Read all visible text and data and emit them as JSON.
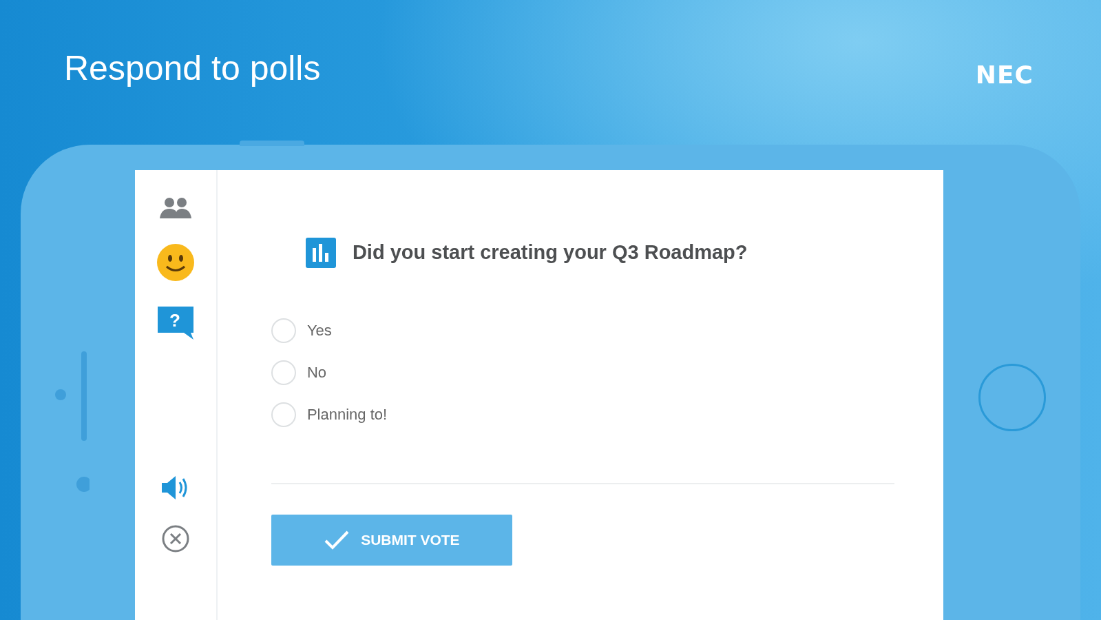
{
  "header": {
    "title": "Respond to polls",
    "logo": "NEC"
  },
  "sidebar": {
    "items": [
      {
        "kind": "participants",
        "selected": false
      },
      {
        "kind": "emoji",
        "selected": false
      },
      {
        "kind": "question",
        "selected": true,
        "glyph": "?"
      }
    ],
    "bottom_items": [
      {
        "kind": "audio",
        "selected": false
      },
      {
        "kind": "close",
        "selected": false
      }
    ]
  },
  "poll": {
    "question": "Did you start creating your Q3 Roadmap?",
    "options": [
      {
        "label": "Yes",
        "selected": false
      },
      {
        "label": "No",
        "selected": false
      },
      {
        "label": "Planning to!",
        "selected": false
      }
    ],
    "submit_button": "SUBMIT VOTE"
  }
}
